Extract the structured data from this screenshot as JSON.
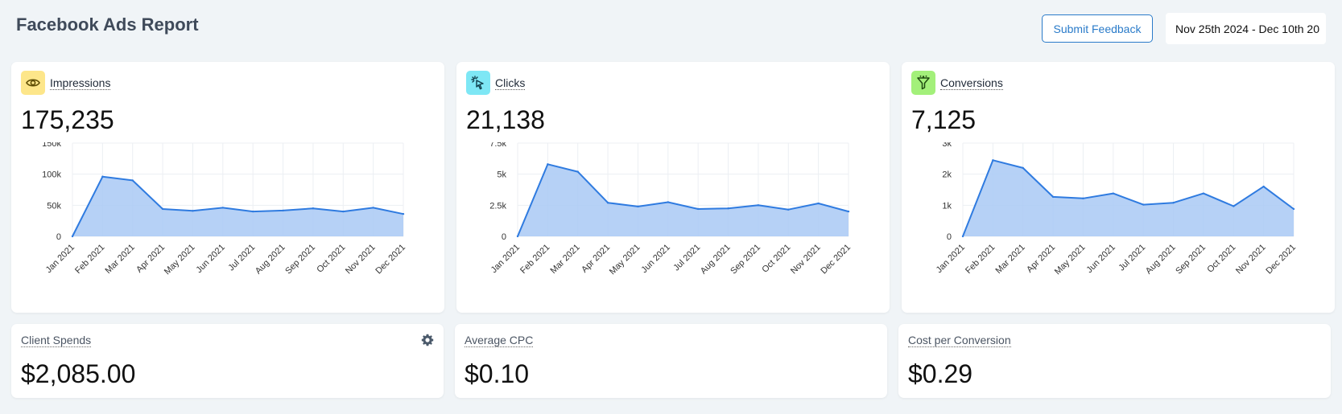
{
  "header": {
    "title": "Facebook Ads Report",
    "feedback_label": "Submit Feedback",
    "date_range": "Nov 25th 2024 - Dec 10th 20"
  },
  "colors": {
    "accent": "#2a7bc9",
    "line": "#2f7be0",
    "area": "#a9c9f5",
    "impressions_icon_bg": "#fde68a",
    "clicks_icon_bg": "#7ee7f5",
    "conversions_icon_bg": "#a3f07a"
  },
  "cards": [
    {
      "label": "Impressions",
      "value": "175,235",
      "icon": "eye-icon",
      "y_ticks": [
        "150k",
        "100k",
        "50k",
        "0"
      ],
      "y_tick_values": [
        150000,
        100000,
        50000,
        0
      ]
    },
    {
      "label": "Clicks",
      "value": "21,138",
      "icon": "cursor-click-icon",
      "y_ticks": [
        "7.5k",
        "5k",
        "2.5k",
        "0"
      ],
      "y_tick_values": [
        7500,
        5000,
        2500,
        0
      ]
    },
    {
      "label": "Conversions",
      "value": "7,125",
      "icon": "funnel-icon",
      "y_ticks": [
        "3k",
        "2k",
        "1k",
        "0"
      ],
      "y_tick_values": [
        3000,
        2000,
        1000,
        0
      ]
    }
  ],
  "kpis": [
    {
      "label": "Client Spends",
      "value": "$2,085.00",
      "icon": "gear-icon"
    },
    {
      "label": "Average CPC",
      "value": "$0.10"
    },
    {
      "label": "Cost per Conversion",
      "value": "$0.29"
    }
  ],
  "chart_data": [
    {
      "type": "area",
      "x": [
        "Jan 2021",
        "Feb 2021",
        "Mar 2021",
        "Apr 2021",
        "May 2021",
        "Jun 2021",
        "Jul 2021",
        "Aug 2021",
        "Sep 2021",
        "Oct 2021",
        "Nov 2021",
        "Dec 2021"
      ],
      "series": [
        {
          "values": [
            0,
            96000,
            90000,
            44000,
            41000,
            46000,
            40000,
            41500,
            45000,
            40000,
            46000,
            36000
          ]
        }
      ],
      "ylim": [
        0,
        150000
      ],
      "grid": true
    },
    {
      "type": "area",
      "x": [
        "Jan 2021",
        "Feb 2021",
        "Mar 2021",
        "Apr 2021",
        "May 2021",
        "Jun 2021",
        "Jul 2021",
        "Aug 2021",
        "Sep 2021",
        "Oct 2021",
        "Nov 2021",
        "Dec 2021"
      ],
      "series": [
        {
          "values": [
            0,
            5800,
            5200,
            2700,
            2400,
            2750,
            2200,
            2250,
            2500,
            2150,
            2650,
            2000
          ]
        }
      ],
      "ylim": [
        0,
        7500
      ],
      "grid": true
    },
    {
      "type": "area",
      "x": [
        "Jan 2021",
        "Feb 2021",
        "Mar 2021",
        "Apr 2021",
        "May 2021",
        "Jun 2021",
        "Jul 2021",
        "Aug 2021",
        "Sep 2021",
        "Oct 2021",
        "Nov 2021",
        "Dec 2021"
      ],
      "series": [
        {
          "values": [
            0,
            2450,
            2200,
            1270,
            1220,
            1380,
            1020,
            1080,
            1380,
            970,
            1600,
            880
          ]
        }
      ],
      "ylim": [
        0,
        3000
      ],
      "grid": true
    }
  ]
}
